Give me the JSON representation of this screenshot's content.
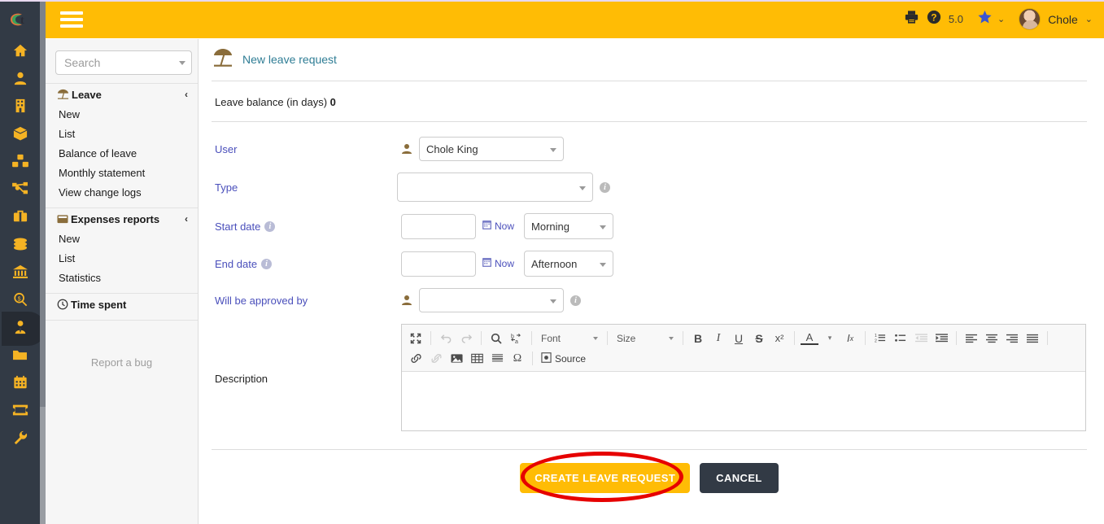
{
  "app": {
    "brand_logo": "ct-logo",
    "header_color": "#ffbc05",
    "sidebar_color": "#323a45",
    "accent_link_color": "#4a4fbb"
  },
  "topbar": {
    "menu_toggle": "hamburger-menu",
    "print_icon": "printer-icon",
    "help_icon": "help-question-icon",
    "version": "5.0",
    "star_icon": "star-icon",
    "star_caret": "⌄",
    "user_name": "Chole",
    "user_caret": "⌄"
  },
  "rail": {
    "items": [
      {
        "name": "home",
        "icon": "home-icon",
        "active": false
      },
      {
        "name": "members",
        "icon": "user-icon",
        "active": false
      },
      {
        "name": "third-parties",
        "icon": "building-icon",
        "active": false
      },
      {
        "name": "products",
        "icon": "box-icon",
        "active": false
      },
      {
        "name": "stock",
        "icon": "boxes-icon",
        "active": false
      },
      {
        "name": "commercial",
        "icon": "sitemap-icon",
        "active": false
      },
      {
        "name": "billing",
        "icon": "briefcase-icon",
        "active": false
      },
      {
        "name": "bank-cash",
        "icon": "coins-icon",
        "active": false
      },
      {
        "name": "accounting",
        "icon": "bank-icon",
        "active": false
      },
      {
        "name": "donations",
        "icon": "search-money-icon",
        "active": false
      },
      {
        "name": "hrm",
        "icon": "user-tie-icon",
        "active": true
      },
      {
        "name": "documents",
        "icon": "folder-icon",
        "active": false
      },
      {
        "name": "agenda",
        "icon": "calendar-icon",
        "active": false
      },
      {
        "name": "tickets",
        "icon": "ticket-icon",
        "active": false
      },
      {
        "name": "setup",
        "icon": "wrench-icon",
        "active": false
      }
    ]
  },
  "menu": {
    "search_placeholder": "Search",
    "search_value": "",
    "search_caret_icon": "chevron-down-icon",
    "groups": [
      {
        "title": "Leave",
        "icon": "beach-umbrella-icon",
        "chevron": "‹",
        "links": [
          "New",
          "List",
          "Balance of leave",
          "Monthly statement",
          "View change logs"
        ]
      },
      {
        "title": "Expenses reports",
        "icon": "expense-report-icon",
        "chevron": "‹",
        "links": [
          "New",
          "List",
          "Statistics"
        ]
      },
      {
        "title": "Time spent",
        "icon": "clock-icon",
        "chevron": "",
        "links": []
      }
    ],
    "report_bug": "Report a bug"
  },
  "page": {
    "icon": "beach-umbrella-icon",
    "title": "New leave request",
    "balance_label": "Leave balance (in days)",
    "balance_value": "0"
  },
  "form": {
    "user": {
      "label": "User",
      "icon": "person-icon",
      "value": "Chole King",
      "caret_icon": "chevron-down-icon"
    },
    "type": {
      "label": "Type",
      "value": "",
      "caret_icon": "chevron-down-icon",
      "info_icon": "info-icon"
    },
    "start_date": {
      "label": "Start date",
      "info_icon": "info-icon",
      "value": "",
      "now_icon": "calendar-icon",
      "now_label": "Now",
      "half_day": "Morning",
      "caret_icon": "chevron-down-icon"
    },
    "end_date": {
      "label": "End date",
      "info_icon": "info-icon",
      "value": "",
      "now_icon": "calendar-icon",
      "now_label": "Now",
      "half_day": "Afternoon",
      "caret_icon": "chevron-down-icon"
    },
    "approver": {
      "label": "Will be approved by",
      "icon": "person-icon",
      "value": "",
      "caret_icon": "chevron-down-icon",
      "info_icon": "info-icon"
    },
    "description": {
      "label": "Description",
      "value": ""
    }
  },
  "editor": {
    "row1": [
      {
        "name": "maximize-icon",
        "glyph": "⤢",
        "disabled": false
      },
      {
        "name": "separator",
        "glyph": "",
        "disabled": false
      },
      {
        "name": "undo-icon",
        "glyph": "↩",
        "disabled": true
      },
      {
        "name": "redo-icon",
        "glyph": "↪",
        "disabled": true
      },
      {
        "name": "separator",
        "glyph": "",
        "disabled": false
      },
      {
        "name": "find-icon",
        "glyph": "🔍",
        "disabled": false
      },
      {
        "name": "replace-icon",
        "glyph": "b↹a",
        "disabled": false
      },
      {
        "name": "separator",
        "glyph": "",
        "disabled": false
      }
    ],
    "font_label": "Font",
    "size_label": "Size",
    "row1b": [
      {
        "name": "bold-icon",
        "glyph": "B",
        "disabled": false
      },
      {
        "name": "italic-icon",
        "glyph": "I",
        "disabled": false
      },
      {
        "name": "underline-icon",
        "glyph": "U",
        "disabled": false
      },
      {
        "name": "strikethrough-icon",
        "glyph": "S",
        "disabled": false
      },
      {
        "name": "superscript-icon",
        "glyph": "x²",
        "disabled": false
      },
      {
        "name": "separator",
        "glyph": "",
        "disabled": false
      },
      {
        "name": "text-color-icon",
        "glyph": "A",
        "disabled": false
      },
      {
        "name": "remove-format-icon",
        "glyph": "Ix",
        "disabled": false
      },
      {
        "name": "separator",
        "glyph": "",
        "disabled": false
      },
      {
        "name": "numbered-list-icon",
        "glyph": "1≡",
        "disabled": false
      },
      {
        "name": "bulleted-list-icon",
        "glyph": "•≡",
        "disabled": false
      },
      {
        "name": "outdent-icon",
        "glyph": "⇤≡",
        "disabled": true
      },
      {
        "name": "indent-icon",
        "glyph": "⇥≡",
        "disabled": false
      },
      {
        "name": "separator",
        "glyph": "",
        "disabled": false
      },
      {
        "name": "align-left-icon",
        "glyph": "≡",
        "disabled": false
      },
      {
        "name": "align-center-icon",
        "glyph": "≡",
        "disabled": false
      },
      {
        "name": "align-right-icon",
        "glyph": "≡",
        "disabled": false
      },
      {
        "name": "align-justify-icon",
        "glyph": "≡",
        "disabled": false
      },
      {
        "name": "separator",
        "glyph": "",
        "disabled": false
      }
    ],
    "row2": [
      {
        "name": "link-icon",
        "glyph": "🔗",
        "disabled": false
      },
      {
        "name": "unlink-icon",
        "glyph": "⛓",
        "disabled": true
      },
      {
        "name": "image-icon",
        "glyph": "🖼",
        "disabled": false
      },
      {
        "name": "table-icon",
        "glyph": "▦",
        "disabled": false
      },
      {
        "name": "horizontal-rule-icon",
        "glyph": "▤",
        "disabled": false
      },
      {
        "name": "special-char-icon",
        "glyph": "Ω",
        "disabled": false
      },
      {
        "name": "separator",
        "glyph": "",
        "disabled": false
      }
    ],
    "source_icon": "source-code-icon",
    "source_label": "Source",
    "body_value": ""
  },
  "actions": {
    "submit_label": "CREATE LEAVE REQUEST",
    "cancel_label": "CANCEL",
    "annotation": "red-ellipse-highlight"
  }
}
